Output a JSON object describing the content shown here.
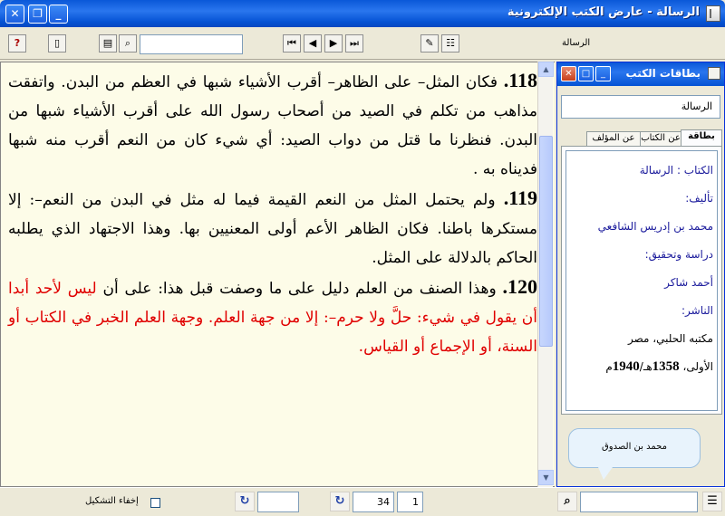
{
  "window": {
    "title": "الرسالة - عارض الكتب الإلكترونية",
    "minimize": "_",
    "restore": "❐",
    "close": "✕"
  },
  "toolbar": {
    "help_glyph": "?",
    "page_glyph": "▯",
    "book_glyph": "▤",
    "search_glyph": "⌕",
    "first_glyph": "⏮",
    "prev_glyph": "◀",
    "next_glyph": "▶",
    "last_glyph": "⏭",
    "bookmark_glyph": "✎",
    "tree_glyph": "☷",
    "search_value": "",
    "book_label": "الرسالة"
  },
  "content": {
    "paragraphs": [
      {
        "num": "118.",
        "text": " فكان المثل– على الظاهر– أقرب الأشياء شبها في العظم من البدن. واتفقت مذاهب من تكلم في الصيد من أصحاب رسول الله على أقرب الأشياء شبها من البدن. فنظرنا ما قتل من دواب الصيد: أي شيء كان من النعم أقرب منه شبها فديناه به .",
        "red_text": ""
      },
      {
        "num": "119.",
        "text": " ولم يحتمل المثل من النعم القيمة فيما له مثل في البدن من النعم–: إلا مستكرها باطنا. فكان الظاهر الأعم أولى المعنيين بها. وهذا الاجتهاد الذي يطلبه الحاكم بالدلالة على المثل.",
        "red_text": ""
      },
      {
        "num": "120.",
        "text": " وهذا الصنف من العلم دليل على ما وصفت قبل هذا: على أن ",
        "red_text": "ليس لأحد أبدا أن يقول في شيء: حلَّ ولا حرم–: إلا من جهة العلم. وجهة العلم الخبر في الكتاب أو السنة، أو الإجماع أو القياس."
      }
    ]
  },
  "panel": {
    "title": "بطاقات الكتب",
    "book_name": "الرسالة",
    "tabs": [
      "بطاقة",
      "عن الكتاب",
      "عن المؤلف"
    ],
    "card": {
      "book_label": "الكتاب : الرسالة",
      "author_label": "تأليف:",
      "author": "محمد بن إدريس الشافعي",
      "editor_label": "دراسة وتحقيق:",
      "editor": "أحمد شاكر",
      "publisher_label": "الناشر:",
      "publisher": "مكتبه الحلبي، مصر",
      "edition_prefix": "الأولى، ",
      "edition_hijri": "1358",
      "edition_mid": "هـ/",
      "edition_greg": "1940",
      "edition_suffix": "م"
    },
    "bubble": "محمد بن الصدوق"
  },
  "status": {
    "hide_diacritics_label": "إخفاء التشكيل",
    "page_value": "34",
    "part_value": "1",
    "goto_glyph": "↻",
    "field_a": "",
    "field_b": "",
    "search_value": "",
    "find_glyph": "⌕",
    "menu_glyph": "☰"
  }
}
